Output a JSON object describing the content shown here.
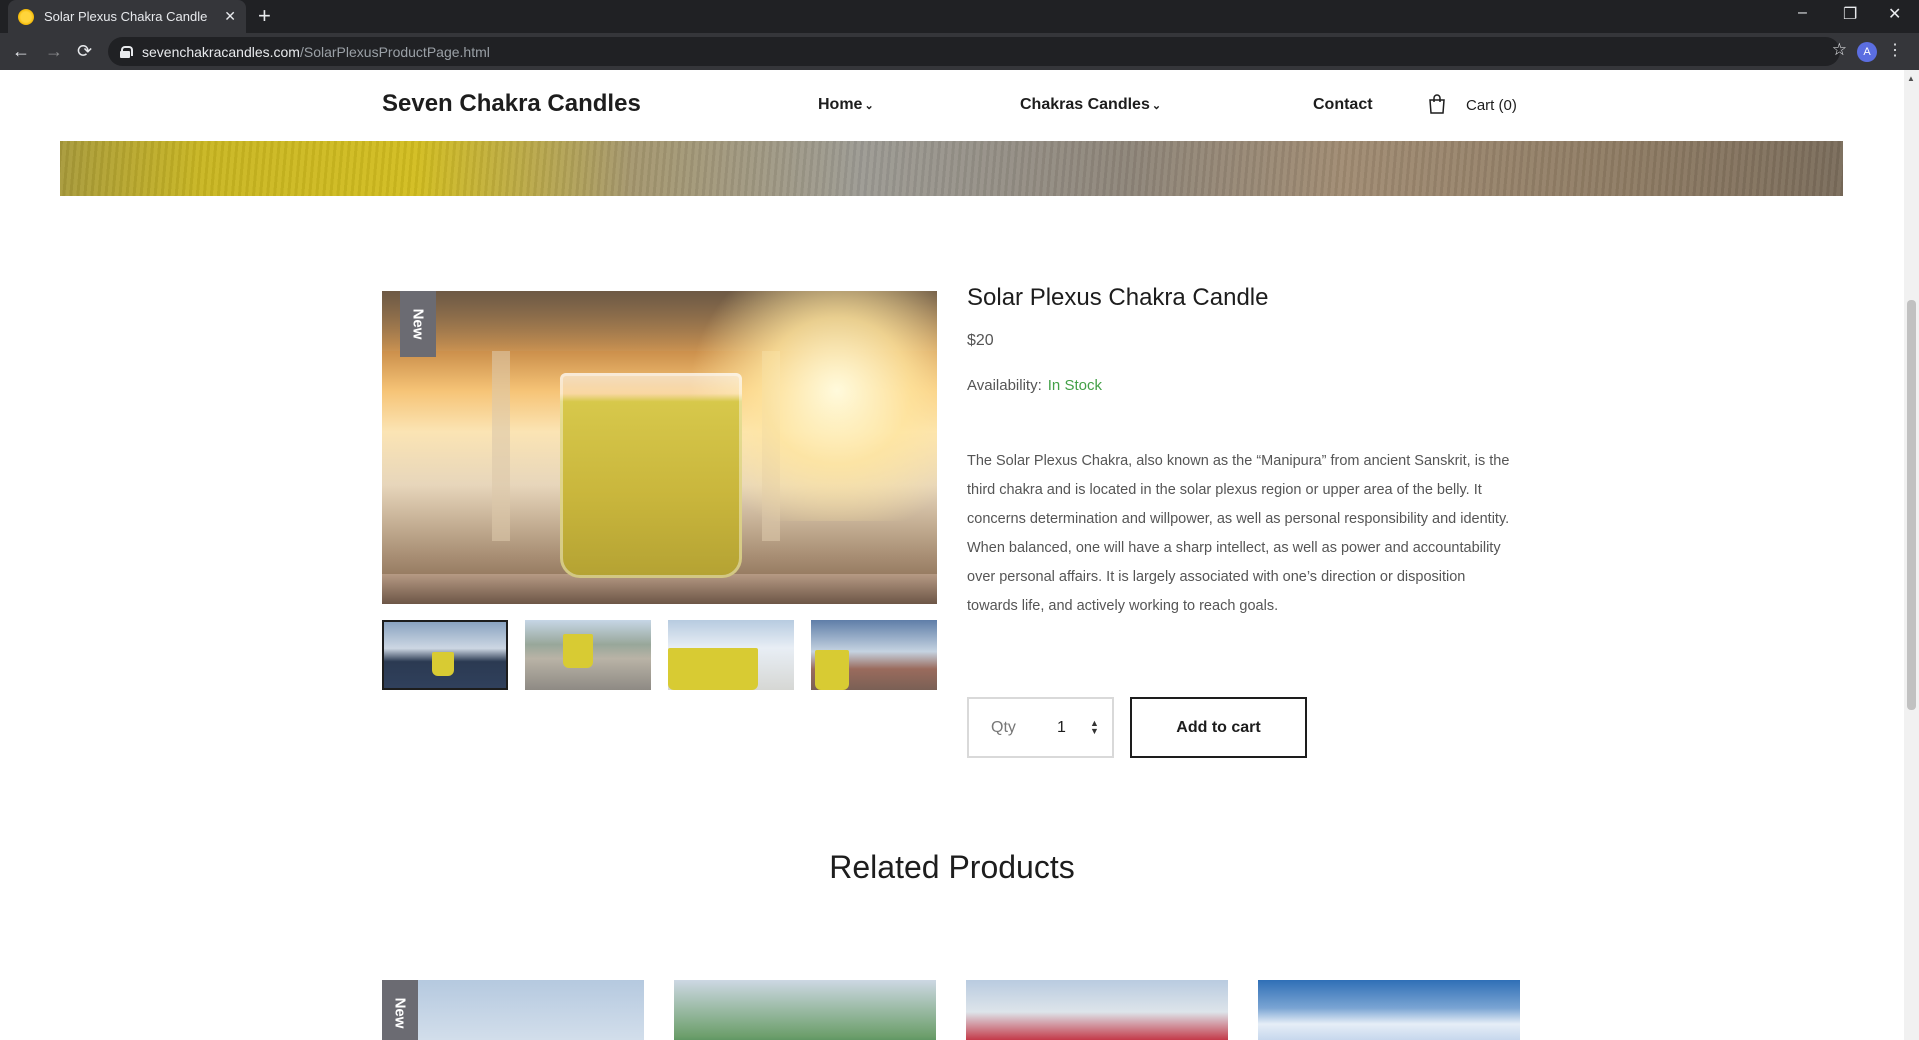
{
  "browser": {
    "tab_title": "Solar Plexus Chakra Candle",
    "tab_close": "✕",
    "new_tab": "+",
    "url_domain": "sevenchakracandles.com",
    "url_path": "/SolarPlexusProductPage.html",
    "profile_initial": "A",
    "controls": {
      "minimize": "–",
      "restore": "❐",
      "close": "✕"
    },
    "nav": {
      "back": "←",
      "forward": "→",
      "reload": "⟳",
      "star": "☆",
      "menu": "⋮"
    }
  },
  "site": {
    "brand": "Seven Chakra Candles",
    "nav": {
      "home": "Home",
      "chakras": "Chakras Candles",
      "contact": "Contact",
      "cart": "Cart (0)"
    },
    "chevron": "⌄"
  },
  "product": {
    "badge": "New",
    "title": "Solar Plexus Chakra Candle",
    "price": "$20",
    "availability_label": "Availability:",
    "availability_value": "In Stock",
    "description": "The Solar Plexus Chakra, also known as the “Manipura” from ancient Sanskrit, is the third chakra and is located in the solar plexus region or upper area of the belly. It concerns determination and willpower, as well as personal responsibility and identity. When balanced, one will have a sharp intellect, as well as power and accountability over personal affairs. It is largely associated with one’s direction or disposition towards life, and actively working to reach goals.",
    "qty_label": "Qty",
    "qty_value": "1",
    "add_to_cart": "Add to cart",
    "thumbnail_count": 4
  },
  "related": {
    "heading": "Related Products",
    "first_badge": "New"
  },
  "colors": {
    "in_stock": "#43a047",
    "badge": "#6b6b72",
    "text_dark": "#1d1d1d"
  }
}
